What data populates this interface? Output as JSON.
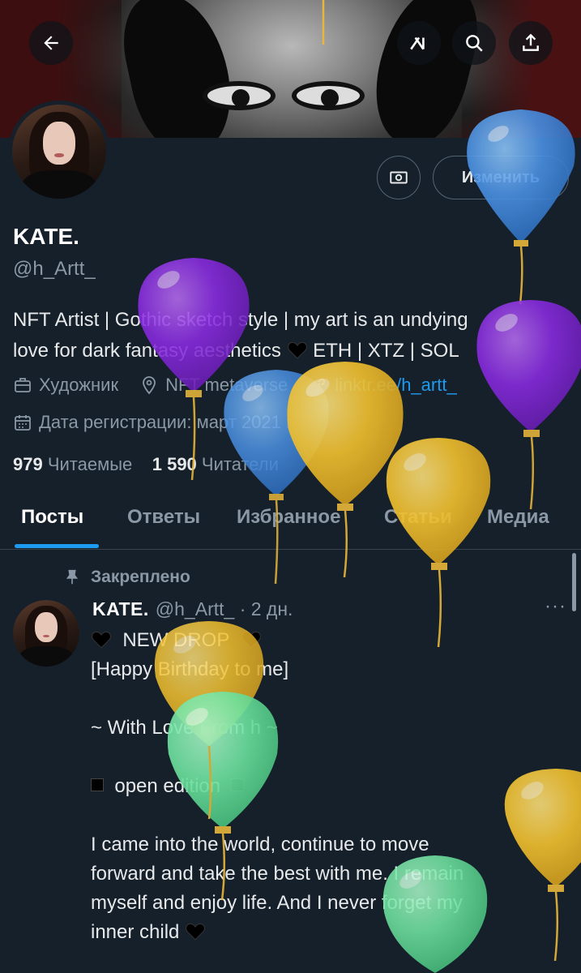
{
  "header": {
    "back_icon": "arrow-left-icon",
    "grok_icon": "grok-icon",
    "search_icon": "search-icon",
    "share_icon": "share-icon"
  },
  "profile": {
    "name": "KATE.",
    "handle": "@h_Artt_",
    "edit_label": "Изменить",
    "bio_line1": "NFT Artist | Gothic sketch style | my art is an undying",
    "bio_line2": "love for dark fantasy aesthetics",
    "bio_line2b": " ETH | XTZ | SOL",
    "profession": "Художник",
    "location": "NFT metaverse",
    "link": "linktr.ee/h_artt_",
    "joined": "Дата регистрации: март 2021 г.",
    "following_count": "979",
    "following_label": "Читаемые",
    "followers_count": "1 590",
    "followers_label": "Читатели"
  },
  "tabs": [
    {
      "label": "Посты",
      "active": true
    },
    {
      "label": "Ответы",
      "active": false
    },
    {
      "label": "Избранное",
      "active": false
    },
    {
      "label": "Статьи",
      "active": false
    },
    {
      "label": "Медиа",
      "active": false
    }
  ],
  "post": {
    "pinned_label": "Закреплено",
    "author": "KATE.",
    "handle": "@h_Artt_",
    "time": "· 2 дн.",
    "more": "···",
    "line1": "NEW DROP",
    "line2": "[Happy Birthday to me]",
    "line3": "~ With Love From h ~",
    "line4": "open edition",
    "line5": "I came into the world, continue to move",
    "line6": "forward and take the best with me. I remain",
    "line7": "myself and enjoy life. And I never forget my",
    "line8": "inner child"
  },
  "colors": {
    "background": "#15202b",
    "accent": "#1d9bf0",
    "muted": "#8b98a5",
    "balloon_blue": "#4a90e2",
    "balloon_purple": "#8a2be2",
    "balloon_yellow": "#f2c12e",
    "balloon_green": "#6fe3a0"
  }
}
